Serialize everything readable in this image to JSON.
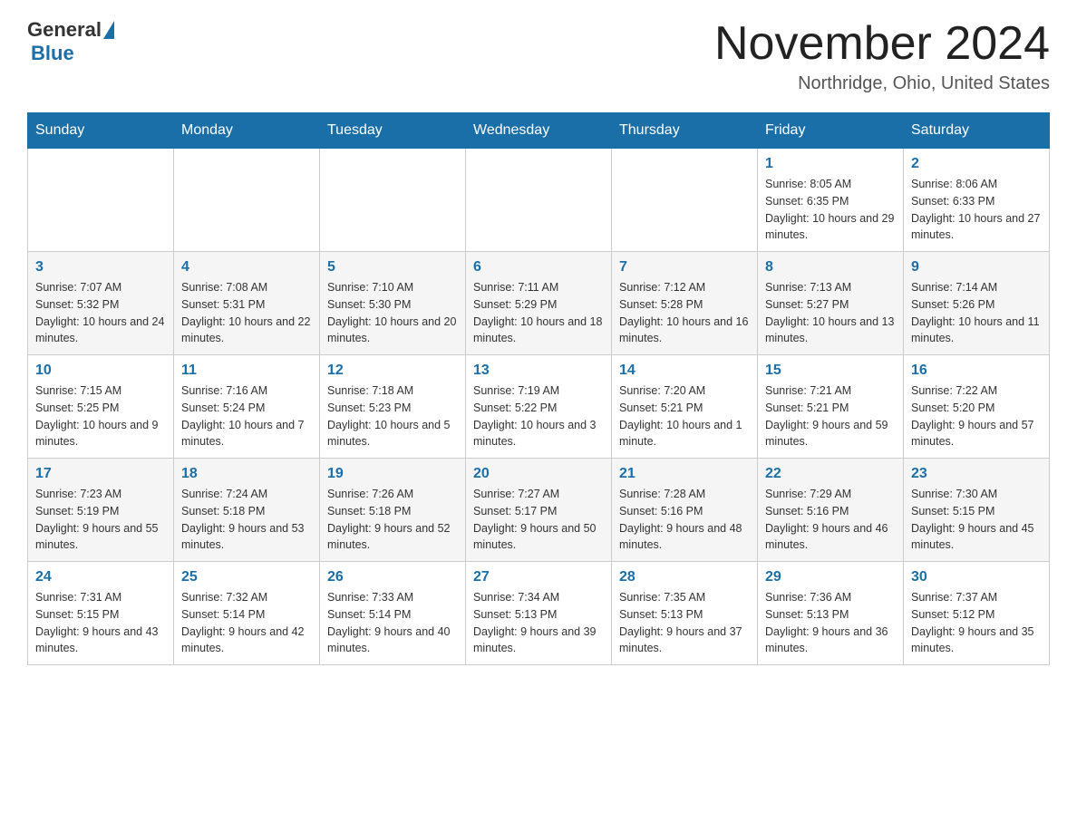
{
  "header": {
    "logo_general": "General",
    "logo_blue": "Blue",
    "month_title": "November 2024",
    "location": "Northridge, Ohio, United States"
  },
  "weekdays": [
    "Sunday",
    "Monday",
    "Tuesday",
    "Wednesday",
    "Thursday",
    "Friday",
    "Saturday"
  ],
  "weeks": [
    {
      "days": [
        {
          "number": "",
          "sunrise": "",
          "sunset": "",
          "daylight": ""
        },
        {
          "number": "",
          "sunrise": "",
          "sunset": "",
          "daylight": ""
        },
        {
          "number": "",
          "sunrise": "",
          "sunset": "",
          "daylight": ""
        },
        {
          "number": "",
          "sunrise": "",
          "sunset": "",
          "daylight": ""
        },
        {
          "number": "",
          "sunrise": "",
          "sunset": "",
          "daylight": ""
        },
        {
          "number": "1",
          "sunrise": "Sunrise: 8:05 AM",
          "sunset": "Sunset: 6:35 PM",
          "daylight": "Daylight: 10 hours and 29 minutes."
        },
        {
          "number": "2",
          "sunrise": "Sunrise: 8:06 AM",
          "sunset": "Sunset: 6:33 PM",
          "daylight": "Daylight: 10 hours and 27 minutes."
        }
      ]
    },
    {
      "days": [
        {
          "number": "3",
          "sunrise": "Sunrise: 7:07 AM",
          "sunset": "Sunset: 5:32 PM",
          "daylight": "Daylight: 10 hours and 24 minutes."
        },
        {
          "number": "4",
          "sunrise": "Sunrise: 7:08 AM",
          "sunset": "Sunset: 5:31 PM",
          "daylight": "Daylight: 10 hours and 22 minutes."
        },
        {
          "number": "5",
          "sunrise": "Sunrise: 7:10 AM",
          "sunset": "Sunset: 5:30 PM",
          "daylight": "Daylight: 10 hours and 20 minutes."
        },
        {
          "number": "6",
          "sunrise": "Sunrise: 7:11 AM",
          "sunset": "Sunset: 5:29 PM",
          "daylight": "Daylight: 10 hours and 18 minutes."
        },
        {
          "number": "7",
          "sunrise": "Sunrise: 7:12 AM",
          "sunset": "Sunset: 5:28 PM",
          "daylight": "Daylight: 10 hours and 16 minutes."
        },
        {
          "number": "8",
          "sunrise": "Sunrise: 7:13 AM",
          "sunset": "Sunset: 5:27 PM",
          "daylight": "Daylight: 10 hours and 13 minutes."
        },
        {
          "number": "9",
          "sunrise": "Sunrise: 7:14 AM",
          "sunset": "Sunset: 5:26 PM",
          "daylight": "Daylight: 10 hours and 11 minutes."
        }
      ]
    },
    {
      "days": [
        {
          "number": "10",
          "sunrise": "Sunrise: 7:15 AM",
          "sunset": "Sunset: 5:25 PM",
          "daylight": "Daylight: 10 hours and 9 minutes."
        },
        {
          "number": "11",
          "sunrise": "Sunrise: 7:16 AM",
          "sunset": "Sunset: 5:24 PM",
          "daylight": "Daylight: 10 hours and 7 minutes."
        },
        {
          "number": "12",
          "sunrise": "Sunrise: 7:18 AM",
          "sunset": "Sunset: 5:23 PM",
          "daylight": "Daylight: 10 hours and 5 minutes."
        },
        {
          "number": "13",
          "sunrise": "Sunrise: 7:19 AM",
          "sunset": "Sunset: 5:22 PM",
          "daylight": "Daylight: 10 hours and 3 minutes."
        },
        {
          "number": "14",
          "sunrise": "Sunrise: 7:20 AM",
          "sunset": "Sunset: 5:21 PM",
          "daylight": "Daylight: 10 hours and 1 minute."
        },
        {
          "number": "15",
          "sunrise": "Sunrise: 7:21 AM",
          "sunset": "Sunset: 5:21 PM",
          "daylight": "Daylight: 9 hours and 59 minutes."
        },
        {
          "number": "16",
          "sunrise": "Sunrise: 7:22 AM",
          "sunset": "Sunset: 5:20 PM",
          "daylight": "Daylight: 9 hours and 57 minutes."
        }
      ]
    },
    {
      "days": [
        {
          "number": "17",
          "sunrise": "Sunrise: 7:23 AM",
          "sunset": "Sunset: 5:19 PM",
          "daylight": "Daylight: 9 hours and 55 minutes."
        },
        {
          "number": "18",
          "sunrise": "Sunrise: 7:24 AM",
          "sunset": "Sunset: 5:18 PM",
          "daylight": "Daylight: 9 hours and 53 minutes."
        },
        {
          "number": "19",
          "sunrise": "Sunrise: 7:26 AM",
          "sunset": "Sunset: 5:18 PM",
          "daylight": "Daylight: 9 hours and 52 minutes."
        },
        {
          "number": "20",
          "sunrise": "Sunrise: 7:27 AM",
          "sunset": "Sunset: 5:17 PM",
          "daylight": "Daylight: 9 hours and 50 minutes."
        },
        {
          "number": "21",
          "sunrise": "Sunrise: 7:28 AM",
          "sunset": "Sunset: 5:16 PM",
          "daylight": "Daylight: 9 hours and 48 minutes."
        },
        {
          "number": "22",
          "sunrise": "Sunrise: 7:29 AM",
          "sunset": "Sunset: 5:16 PM",
          "daylight": "Daylight: 9 hours and 46 minutes."
        },
        {
          "number": "23",
          "sunrise": "Sunrise: 7:30 AM",
          "sunset": "Sunset: 5:15 PM",
          "daylight": "Daylight: 9 hours and 45 minutes."
        }
      ]
    },
    {
      "days": [
        {
          "number": "24",
          "sunrise": "Sunrise: 7:31 AM",
          "sunset": "Sunset: 5:15 PM",
          "daylight": "Daylight: 9 hours and 43 minutes."
        },
        {
          "number": "25",
          "sunrise": "Sunrise: 7:32 AM",
          "sunset": "Sunset: 5:14 PM",
          "daylight": "Daylight: 9 hours and 42 minutes."
        },
        {
          "number": "26",
          "sunrise": "Sunrise: 7:33 AM",
          "sunset": "Sunset: 5:14 PM",
          "daylight": "Daylight: 9 hours and 40 minutes."
        },
        {
          "number": "27",
          "sunrise": "Sunrise: 7:34 AM",
          "sunset": "Sunset: 5:13 PM",
          "daylight": "Daylight: 9 hours and 39 minutes."
        },
        {
          "number": "28",
          "sunrise": "Sunrise: 7:35 AM",
          "sunset": "Sunset: 5:13 PM",
          "daylight": "Daylight: 9 hours and 37 minutes."
        },
        {
          "number": "29",
          "sunrise": "Sunrise: 7:36 AM",
          "sunset": "Sunset: 5:13 PM",
          "daylight": "Daylight: 9 hours and 36 minutes."
        },
        {
          "number": "30",
          "sunrise": "Sunrise: 7:37 AM",
          "sunset": "Sunset: 5:12 PM",
          "daylight": "Daylight: 9 hours and 35 minutes."
        }
      ]
    }
  ]
}
